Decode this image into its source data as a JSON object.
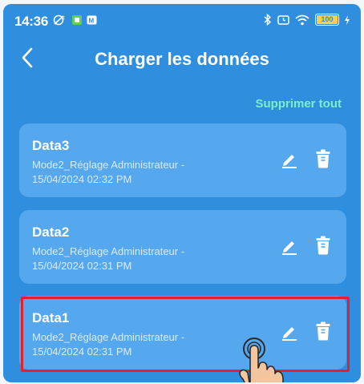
{
  "status_bar": {
    "time": "14:36",
    "battery": "100"
  },
  "header": {
    "title": "Charger les données"
  },
  "actions": {
    "delete_all": "Supprimer tout"
  },
  "items": [
    {
      "name": "Data3",
      "line1": "Mode2_Réglage Administrateur -",
      "line2": "15/04/2024 02:32 PM"
    },
    {
      "name": "Data2",
      "line1": "Mode2_Réglage Administrateur -",
      "line2": "15/04/2024 02:31 PM"
    },
    {
      "name": "Data1",
      "line1": "Mode2_Réglage Administrateur -",
      "line2": "15/04/2024 02:31 PM"
    }
  ],
  "colors": {
    "background": "#2f8ede",
    "card": "#55a7ee",
    "accent": "#7bf0c8",
    "highlight": "#e0232b"
  }
}
